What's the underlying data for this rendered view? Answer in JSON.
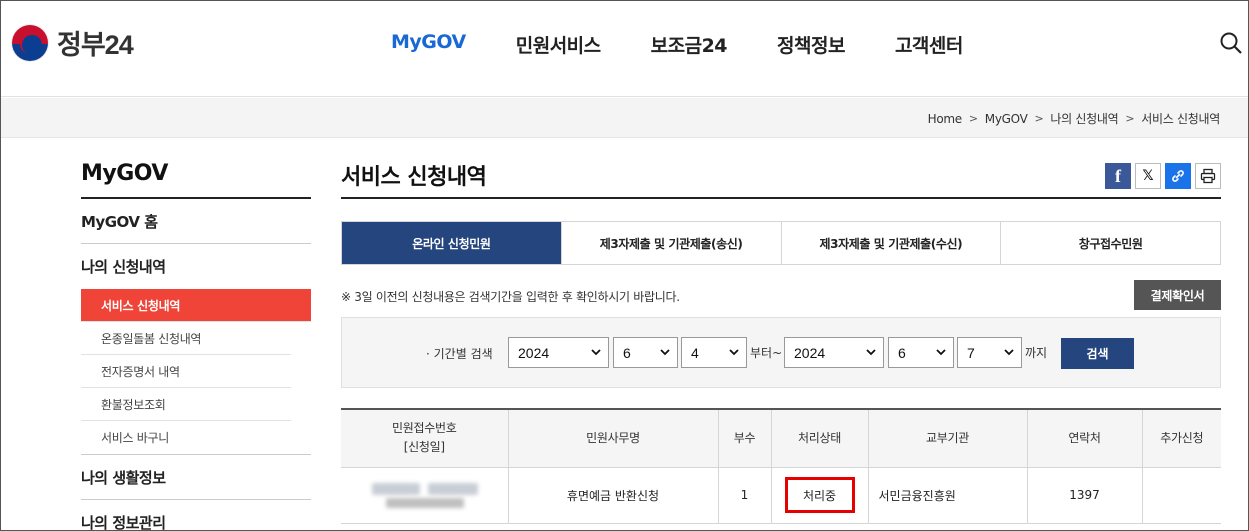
{
  "header": {
    "logo_text": "정부24",
    "nav": [
      "MyGOV",
      "민원서비스",
      "보조금24",
      "정책정보",
      "고객센터"
    ],
    "active_nav": "MyGOV"
  },
  "breadcrumb": [
    "Home",
    "MyGOV",
    "나의 신청내역",
    "서비스 신청내역"
  ],
  "sidebar": {
    "title": "MyGOV",
    "home": "MyGOV 홈",
    "section1": "나의 신청내역",
    "sub_items": [
      "서비스 신청내역",
      "온종일돌봄 신청내역",
      "전자증명서 내역",
      "환불정보조회",
      "서비스 바구니"
    ],
    "section2": "나의 생활정보",
    "section3": "나의 정보관리"
  },
  "content": {
    "title": "서비스 신청내역",
    "tabs": [
      "온라인 신청민원",
      "제3자제출 및 기관제출(송신)",
      "제3자제출 및 기관제출(수신)",
      "창구접수민원"
    ],
    "notice": "※ 3일 이전의 신청내용은 검색기간을 입력한 후 확인하시기 바랍니다.",
    "confirm_button": "결제확인서"
  },
  "search": {
    "label": "· 기간별 검색",
    "start_year": "2024",
    "start_month": "6",
    "start_day": "4",
    "from_text": "부터~",
    "end_year": "2024",
    "end_month": "6",
    "end_day": "7",
    "until_text": "까지",
    "button": "검색"
  },
  "table": {
    "headers": [
      "민원접수번호",
      "[신청일]",
      "민원사무명",
      "부수",
      "처리상태",
      "교부기관",
      "연락처",
      "추가신청"
    ],
    "row": {
      "name": "휴면예금 반환신청",
      "copies": "1",
      "status": "처리중",
      "agency": "서민금융진흥원",
      "contact": "1397",
      "extra": ""
    }
  },
  "colors": {
    "nav_active": "#1868d6",
    "tab_active": "#24457e",
    "sidebar_active": "#f04438",
    "status_highlight": "#e60000"
  }
}
